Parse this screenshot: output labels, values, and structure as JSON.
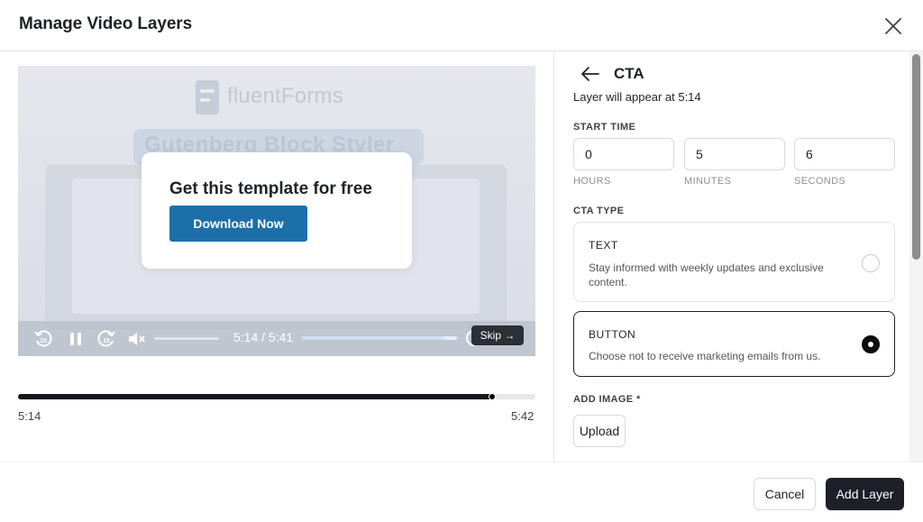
{
  "modal": {
    "title": "Manage Video Layers"
  },
  "video": {
    "brand_text": "fluentForms",
    "banner_text": "Gutenberg Block Styler",
    "cta_heading": "Get this template for free",
    "cta_button_label": "Download Now",
    "time_display": "5:14 / 5:41",
    "skip_label": "Skip →",
    "playback_progress": 0.92,
    "controls": [
      "rewind-10-icon",
      "pause-icon",
      "forward-10-icon",
      "mute-icon"
    ]
  },
  "timeline": {
    "start_label": "5:14",
    "end_label": "5:42",
    "position": 0.917
  },
  "panel": {
    "back_icon": "arrow-left-icon",
    "title": "CTA",
    "appear_text": "Layer will appear at 5:14",
    "start_time_label": "START TIME",
    "hours_value": "0",
    "minutes_value": "5",
    "seconds_value": "6",
    "hours_label": "HOURS",
    "minutes_label": "MINUTES",
    "seconds_label": "SECONDS",
    "cta_type_label": "CTA TYPE",
    "options": [
      {
        "title": "TEXT",
        "description": "Stay informed with weekly updates and exclusive content.",
        "selected": false
      },
      {
        "title": "BUTTON",
        "description": "Choose not to receive marketing emails from us.",
        "selected": true
      }
    ],
    "add_image_label": "ADD IMAGE *",
    "upload_label": "Upload"
  },
  "footer": {
    "cancel_label": "Cancel",
    "add_label": "Add Layer"
  },
  "colors": {
    "cta_button": "#1c6fa8",
    "primary_dark": "#1d2028",
    "border": "#d6d9dd"
  }
}
